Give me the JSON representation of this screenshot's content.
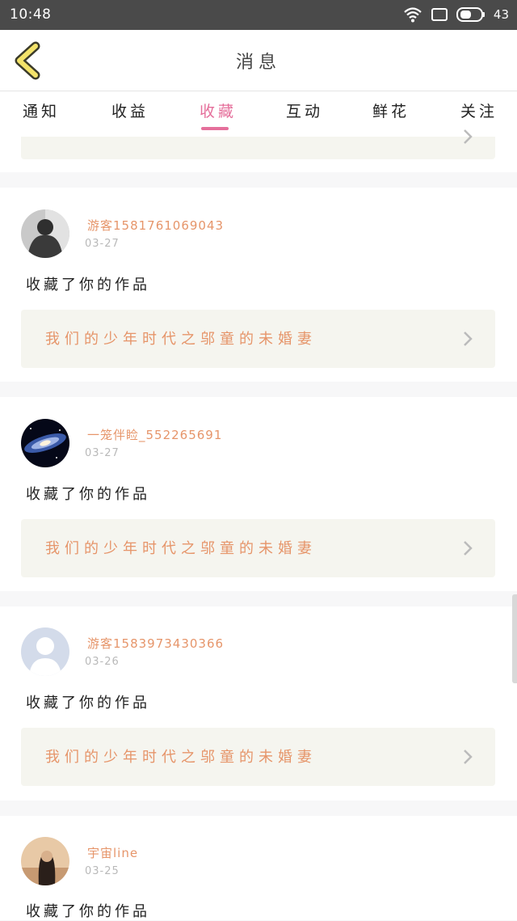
{
  "statusbar": {
    "time": "10:48",
    "battery": "43"
  },
  "header": {
    "title": "消息"
  },
  "tabs": [
    {
      "label": "通知"
    },
    {
      "label": "收益"
    },
    {
      "label": "收藏"
    },
    {
      "label": "互动"
    },
    {
      "label": "鲜花"
    },
    {
      "label": "关注"
    }
  ],
  "active_tab": "收藏",
  "messages": [
    {
      "user": "游客1581761069043",
      "date": "03-27",
      "action": "收藏了你的作品",
      "work": "我们的少年时代之邬童的未婚妻"
    },
    {
      "user": "一笼伴睑_552265691",
      "date": "03-27",
      "action": "收藏了你的作品",
      "work": "我们的少年时代之邬童的未婚妻"
    },
    {
      "user": "游客1583973430366",
      "date": "03-26",
      "action": "收藏了你的作品",
      "work": "我们的少年时代之邬童的未婚妻"
    },
    {
      "user": "宇宙line",
      "date": "03-25",
      "action": "收藏了你的作品"
    }
  ],
  "colors": {
    "accent": "#e56f9b",
    "name": "#e6956a",
    "statusbar": "#4a4a4a"
  }
}
